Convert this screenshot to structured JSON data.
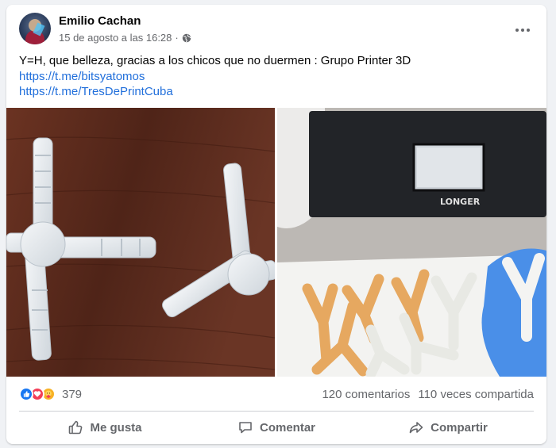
{
  "post": {
    "author": "Emilio Cachan",
    "timestamp": "15 de agosto a las 16:28",
    "separator": "·",
    "audience_icon": "globe-icon",
    "text": "Y=H, que belleza, gracias a los chicos que no duermen : Grupo Printer 3D",
    "links": [
      "https://t.me/bitsyatomos",
      "https://t.me/TresDePrintCuba"
    ]
  },
  "photos": {
    "right": {
      "printer_label": "LONGER"
    }
  },
  "stats": {
    "reaction_icons": [
      "like-icon",
      "love-icon",
      "care-icon"
    ],
    "reaction_count": "379",
    "comments": "120 comentarios",
    "shares": "110 veces compartida"
  },
  "actions": {
    "like": "Me gusta",
    "comment": "Comentar",
    "share": "Compartir"
  },
  "colors": {
    "link": "#216fdb",
    "secondary_text": "#65676b",
    "like_blue": "#1877f2"
  }
}
